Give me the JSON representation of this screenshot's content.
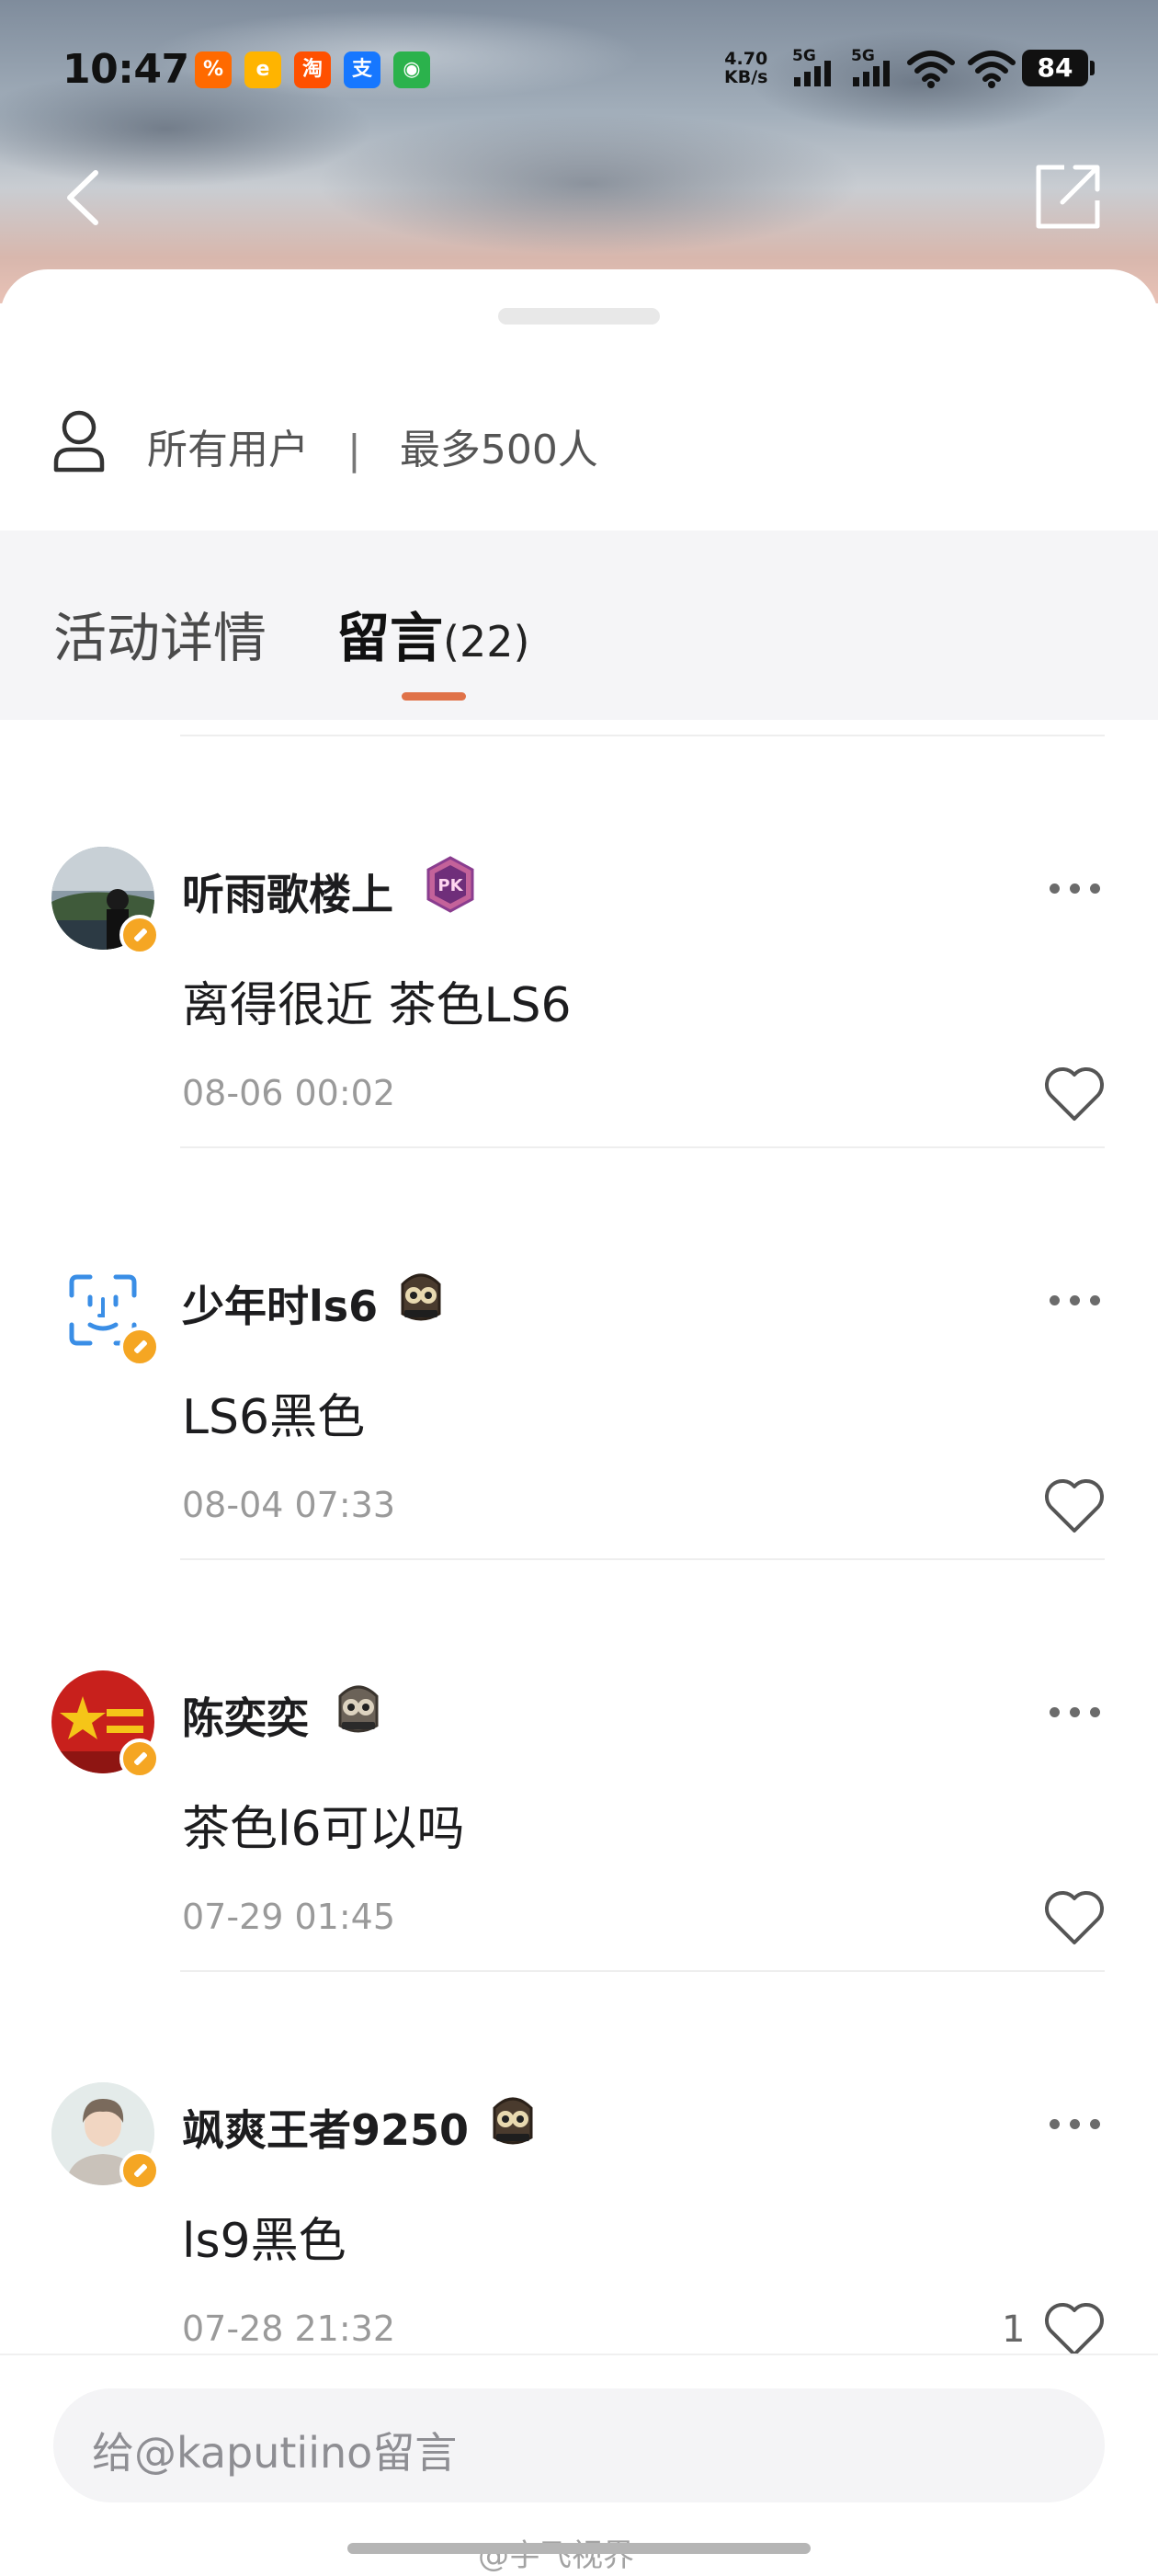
{
  "status_bar": {
    "time": "10:47",
    "net_speed_value": "4.70",
    "net_speed_unit": "KB/s",
    "sim1_label": "5G",
    "sim2_label": "5G",
    "battery": "84",
    "app_icons": [
      {
        "name": "taobao-flash-icon",
        "color": "#ff6a00",
        "glyph": "%"
      },
      {
        "name": "shopping-app-icon",
        "color": "#ffb400",
        "glyph": "e"
      },
      {
        "name": "taobao-icon",
        "color": "#ff5000",
        "glyph": "淘"
      },
      {
        "name": "alipay-icon",
        "color": "#1677ff",
        "glyph": "支"
      },
      {
        "name": "chat-app-icon",
        "color": "#2bb24c",
        "glyph": "◉"
      }
    ]
  },
  "audience": {
    "label": "所有用户",
    "divider": "|",
    "limit": "最多500人"
  },
  "tabs": {
    "detail": "活动详情",
    "messages": "留言",
    "messages_count": "(22)"
  },
  "comments": [
    {
      "user": "听雨歌楼上",
      "text": "离得很近 茶色LS6",
      "time": "08-06 00:02",
      "likes": "",
      "medal": "pk-medal-icon",
      "avatar": "photo"
    },
    {
      "user": "少年时ls6",
      "text": "LS6黑色",
      "time": "08-04 07:33",
      "likes": "",
      "medal": "owl-medal-icon",
      "avatar": "face-id"
    },
    {
      "user": "陈奕奕",
      "text": "茶色l6可以吗",
      "time": "07-29 01:45",
      "likes": "",
      "medal": "owl-medal-icon",
      "avatar": "star"
    },
    {
      "user": "飒爽王者9250",
      "text": "ls9黑色",
      "time": "07-28 21:32",
      "likes": "1",
      "medal": "owl-medal-icon",
      "avatar": "default"
    }
  ],
  "input": {
    "placeholder": "给@kaputiino留言"
  },
  "watermark": "@宇飞视界",
  "colors": {
    "accent": "#e07248",
    "verified_badge": "#f5a623"
  }
}
